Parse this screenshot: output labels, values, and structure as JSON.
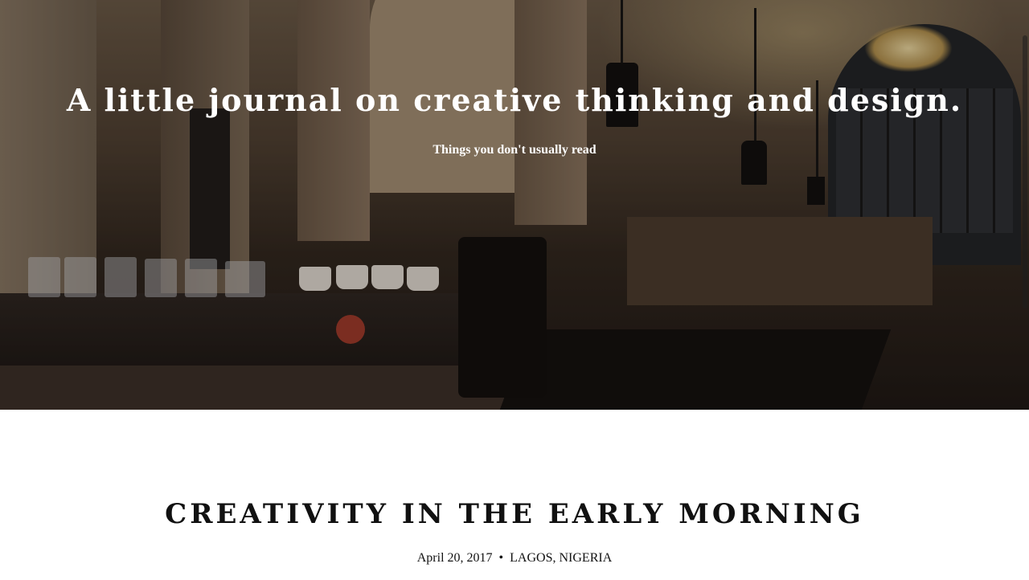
{
  "hero": {
    "title": "A little journal on creative thinking and design.",
    "subtitle": "Things you don't usually read",
    "image_description_icon": "cafe-interior-photo"
  },
  "post": {
    "title": "CREATIVITY IN THE EARLY MORNING",
    "date": "April 20, 2017",
    "separator": "•",
    "location": "LAGOS, NIGERIA"
  },
  "colors": {
    "text_dark": "#111111",
    "hero_text": "#ffffff",
    "page_bg": "#ffffff"
  }
}
